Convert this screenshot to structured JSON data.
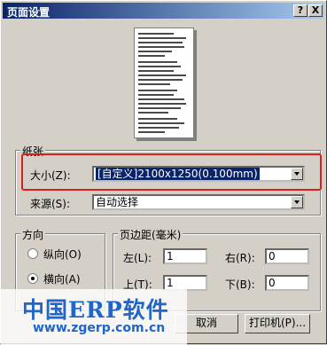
{
  "window": {
    "title": "页面设置"
  },
  "title_buttons": {
    "help": "?",
    "close": "X"
  },
  "paper": {
    "group_label": "纸张",
    "size_label": "大小(Z):",
    "size_value": "[自定义]2100x1250(0.100mm)",
    "source_label": "来源(S):",
    "source_value": "自动选择"
  },
  "orientation": {
    "group_label": "方向",
    "portrait_label": "纵向(O)",
    "landscape_label": "横向(A)",
    "selected": "landscape"
  },
  "margins": {
    "group_label": "页边距(毫米)",
    "left_label": "左(L):",
    "left_value": "1",
    "right_label": "右(R):",
    "right_value": "0",
    "top_label": "上(T):",
    "top_value": "1",
    "bottom_label": "下(B):",
    "bottom_value": "0"
  },
  "buttons": {
    "cancel": "取消",
    "printer": "打印机(P)..."
  },
  "watermark": {
    "name": "中国ERP软件",
    "url": "www.zgerp.com.cn"
  },
  "colors": {
    "highlight_box": "#d91e1e",
    "title_bar": "#0a246a"
  }
}
